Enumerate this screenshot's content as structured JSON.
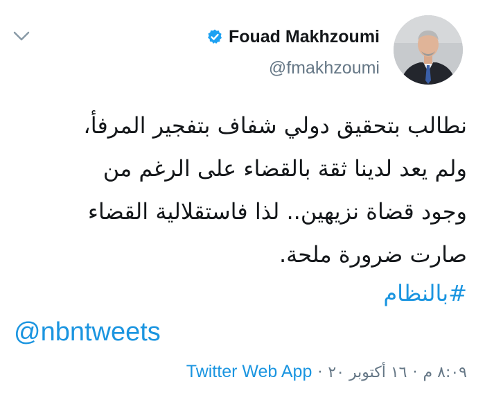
{
  "tweet": {
    "author_name": "Fouad Makhzoumi",
    "handle": "@fmakhzoumi",
    "verified": true,
    "body_lines": [
      "نطالب بتحقيق دولي شفاف بتفجير المرفأ،",
      "ولم يعد لدينا ثقة بالقضاء على الرغم من",
      "وجود قضاة نزيهين.. لذا فاستقلالية القضاء",
      "صارت ضرورة ملحة."
    ],
    "hashtag": "#بالنظام",
    "mention": "@nbntweets",
    "time": "٨:٠٩ م",
    "date": "١٦ أكتوبر ٢٠",
    "separator": "·",
    "source": "Twitter Web App"
  },
  "icons": {
    "menu": "chevron-down-icon",
    "verified": "verified-badge-icon"
  },
  "colors": {
    "link": "#1b95e0",
    "secondary_text": "#657786",
    "primary_text": "#14171a",
    "background": "#ffffff"
  }
}
